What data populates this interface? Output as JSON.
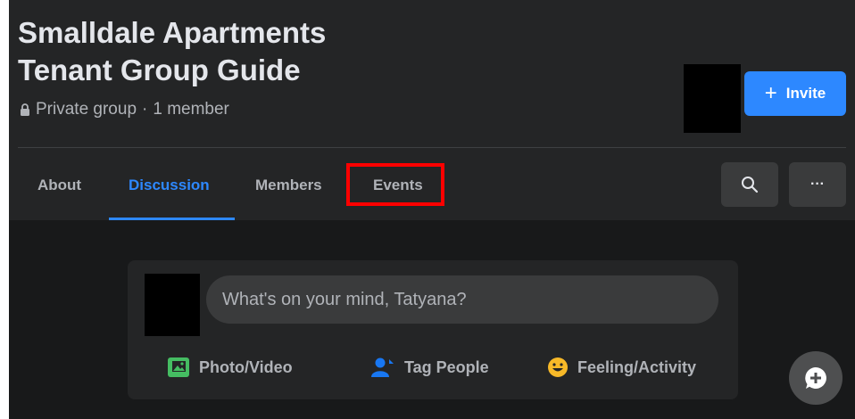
{
  "group": {
    "title_line1": "Smalldale Apartments",
    "title_line2": "Tenant Group Guide",
    "privacy": "Private group",
    "separator": "·",
    "members": "1 member"
  },
  "invite": {
    "icon": "plus-icon",
    "label": "Invite"
  },
  "tabs": [
    {
      "label": "About"
    },
    {
      "label": "Discussion",
      "active": true
    },
    {
      "label": "Members"
    },
    {
      "label": "Events",
      "highlighted": true
    }
  ],
  "toolbar": {
    "search_icon": "search-icon",
    "more_icon": "more-icon",
    "more_label": "···"
  },
  "composer": {
    "placeholder": "What's on your mind, Tatyana?",
    "actions": [
      {
        "icon": "photo-video-icon",
        "label": "Photo/Video",
        "color": "#45bd62"
      },
      {
        "icon": "tag-people-icon",
        "label": "Tag People",
        "color": "#1877f2"
      },
      {
        "icon": "feeling-icon",
        "label": "Feeling/Activity",
        "color": "#f7b928"
      }
    ]
  },
  "colors": {
    "accent": "#2d88ff",
    "highlight": "#ff0000",
    "header_bg": "#242526",
    "page_bg": "#18191a"
  }
}
